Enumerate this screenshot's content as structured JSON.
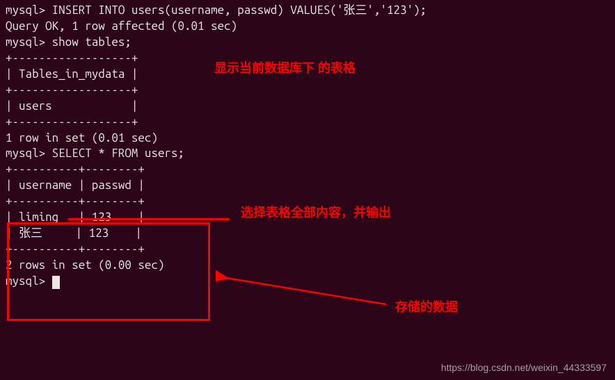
{
  "terminal": {
    "line1": "mysql> INSERT INTO users(username, passwd) VALUES('张三','123');",
    "line2": "Query OK, 1 row affected (0.01 sec)",
    "line3": "",
    "line4": "mysql> show tables;",
    "line5": "+------------------+",
    "line6": "| Tables_in_mydata |",
    "line7": "+------------------+",
    "line8": "| users            |",
    "line9": "+------------------+",
    "line10": "1 row in set (0.01 sec)",
    "line11": "",
    "line12": "mysql> SELECT * FROM users;",
    "line13": "+----------+--------+",
    "line14": "| username | passwd |",
    "line15": "+----------+--------+",
    "line16": "| liming   | 123    |",
    "line17": "| 张三     | 123    |",
    "line18": "+----------+--------+",
    "line19": "2 rows in set (0.00 sec)",
    "line20": "",
    "line21": "mysql> "
  },
  "annotations": {
    "show_tables": "显示当前数据库下 的表格",
    "select_all": "选择表格全部内容，并输出",
    "stored_data": "存储的数据"
  },
  "watermark": "https://blog.csdn.net/weixin_44333597",
  "chart_data": {
    "type": "table",
    "tables": [
      {
        "title": "Tables_in_mydata",
        "columns": [
          "Tables_in_mydata"
        ],
        "rows": [
          [
            "users"
          ]
        ]
      },
      {
        "title": "users",
        "columns": [
          "username",
          "passwd"
        ],
        "rows": [
          [
            "liming",
            "123"
          ],
          [
            "张三",
            "123"
          ]
        ]
      }
    ]
  }
}
